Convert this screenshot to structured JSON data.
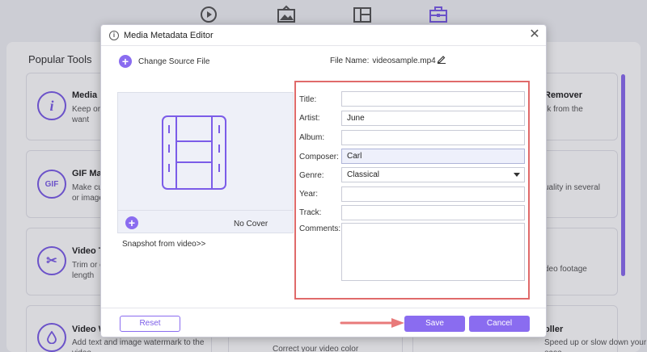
{
  "app": {
    "nav_icons": [
      "converter-icon",
      "mv-icon",
      "collage-icon",
      "toolbox-icon"
    ],
    "panel_title": "Popular Tools",
    "tools_left": [
      {
        "name": "Media M",
        "desc": [
          "Keep orig",
          "want"
        ],
        "icon": "info-icon",
        "glyph": "i"
      },
      {
        "name": "GIF Mak",
        "desc": [
          "Make cus",
          "or image"
        ],
        "icon": "gif-icon",
        "glyph": "GIF"
      },
      {
        "name": "Video Tr",
        "desc": [
          "Trim or c",
          "length"
        ],
        "icon": "scissors-icon",
        "glyph": "✂"
      },
      {
        "name": "Video W",
        "desc": [
          "Add text and image watermark to the",
          "video"
        ],
        "icon": "droplet-icon",
        "glyph": "💧"
      }
    ],
    "tools_right": [
      {
        "name": "Remover",
        "desc": [
          "rk from the",
          ""
        ]
      },
      {
        "name": "",
        "desc": [
          "uality in several",
          ""
        ]
      },
      {
        "name": "",
        "desc": [
          "deo footage",
          ""
        ]
      },
      {
        "name": "oller",
        "desc": [
          "Speed up or slow down your file at",
          "ease"
        ]
      }
    ],
    "tool_middle_bottom": "Correct your video color"
  },
  "dialog": {
    "title": "Media Metadata Editor",
    "change_source": "Change Source File",
    "file_name_label": "File Name:",
    "file_name_value": "videosample.mp4",
    "no_cover": "No Cover",
    "snapshot": "Snapshot from video>>",
    "fields": {
      "title_label": "Title:",
      "title_value": "",
      "artist_label": "Artist:",
      "artist_value": "June",
      "album_label": "Album:",
      "album_value": "",
      "composer_label": "Composer:",
      "composer_value": "Carl",
      "genre_label": "Genre:",
      "genre_value": "Classical",
      "year_label": "Year:",
      "year_value": "",
      "track_label": "Track:",
      "track_value": "",
      "comments_label": "Comments:",
      "comments_value": ""
    },
    "buttons": {
      "reset": "Reset",
      "save": "Save",
      "cancel": "Cancel"
    }
  },
  "colors": {
    "accent": "#8a6cf0",
    "highlight_frame": "#e06a6a",
    "arrow": "#e87a7a"
  }
}
